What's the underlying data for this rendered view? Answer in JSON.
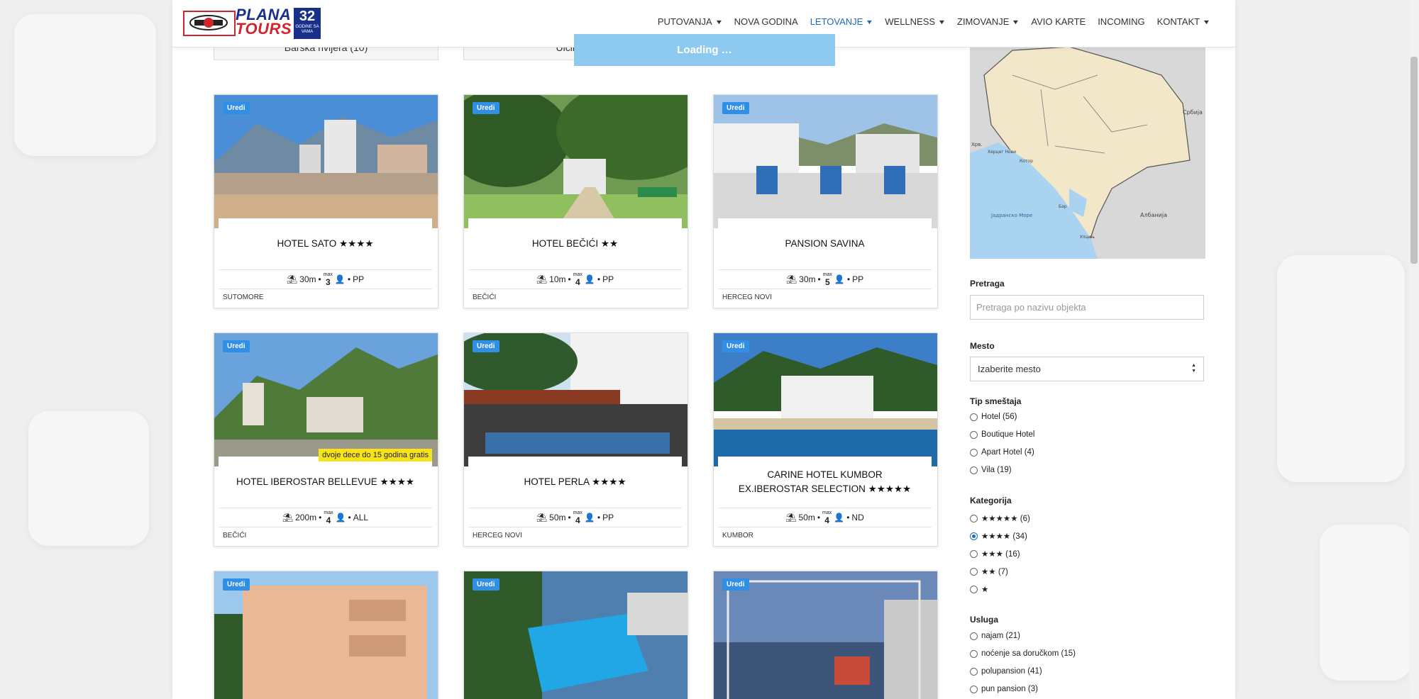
{
  "brand": {
    "name_line1": "PLANA",
    "name_line2": "TOURS",
    "years_number": "32",
    "years_text": "GODINE SA VAMA"
  },
  "nav": [
    {
      "label": "PUTOVANJA",
      "dropdown": true
    },
    {
      "label": "NOVA GODINA",
      "dropdown": false
    },
    {
      "label": "LETOVANJE",
      "dropdown": true,
      "active": true
    },
    {
      "label": "WELLNESS",
      "dropdown": true
    },
    {
      "label": "ZIMOVANJE",
      "dropdown": true
    },
    {
      "label": "AVIO KARTE",
      "dropdown": false
    },
    {
      "label": "INCOMING",
      "dropdown": false
    },
    {
      "label": "KONTAKT",
      "dropdown": true
    }
  ],
  "categories": [
    "Barska rivijera (10)",
    "Ulcinjska"
  ],
  "loading": "Loading",
  "edit_label": "Uredi",
  "hotels": [
    {
      "title": "HOTEL SATO ★★★★",
      "distance": "30m",
      "max_label": "max",
      "max": "3",
      "board": "PP",
      "location": "SUTOMORE"
    },
    {
      "title": "HOTEL BEČIĆI ★★",
      "distance": "10m",
      "max_label": "max",
      "max": "4",
      "board": "PP",
      "location": "BEČIĆI"
    },
    {
      "title": "PANSION SAVINA",
      "distance": "30m",
      "max_label": "max",
      "max": "5",
      "board": "PP",
      "location": "HERCEG NOVI"
    },
    {
      "title": "HOTEL IBEROSTAR BELLEVUE ★★★★",
      "distance": "200m",
      "max_label": "max",
      "max": "4",
      "board": "ALL",
      "location": "BEČIĆI",
      "promo": "dvoje dece do 15 godina gratis"
    },
    {
      "title": "HOTEL PERLA ★★★★",
      "distance": "50m",
      "max_label": "max",
      "max": "4",
      "board": "PP",
      "location": "HERCEG NOVI"
    },
    {
      "title": "CARINE HOTEL KUMBOR EX.IBEROSTAR SELECTION ★★★★★",
      "distance": "50m",
      "max_label": "max",
      "max": "4",
      "board": "ND",
      "location": "KUMBOR"
    }
  ],
  "map": {
    "labels": [
      "Србија",
      "Хрв.",
      "Херцег Нови",
      "Котор",
      "Бар",
      "Јадранско Море",
      "Албанија",
      "Улцињ"
    ]
  },
  "sidebar": {
    "search_label": "Pretraga",
    "search_placeholder": "Pretraga po nazivu objekta",
    "city_label": "Mesto",
    "city_value": "Izaberite mesto",
    "type_label": "Tip smeštaja",
    "types": [
      "Hotel (56)",
      "Boutique Hotel",
      "Apart Hotel (4)",
      "Vila (19)"
    ],
    "category_label": "Kategorija",
    "categories": [
      "★★★★★ (6)",
      "★★★★ (34)",
      "★★★ (16)",
      "★★ (7)",
      "★"
    ],
    "category_selected": "★★★★ (34)",
    "service_label": "Usluga",
    "services": [
      "najam (21)",
      "noćenje sa doručkom (15)",
      "polupansion (41)",
      "pun pansion (3)"
    ]
  },
  "colors": {
    "brand_blue": "#1a2f8c",
    "brand_red": "#d3232e",
    "accent": "#1e6bb8",
    "edit_badge": "#2f8ee6",
    "promo_badge": "#f7e31a",
    "loading_bar": "#8ec9ef"
  }
}
